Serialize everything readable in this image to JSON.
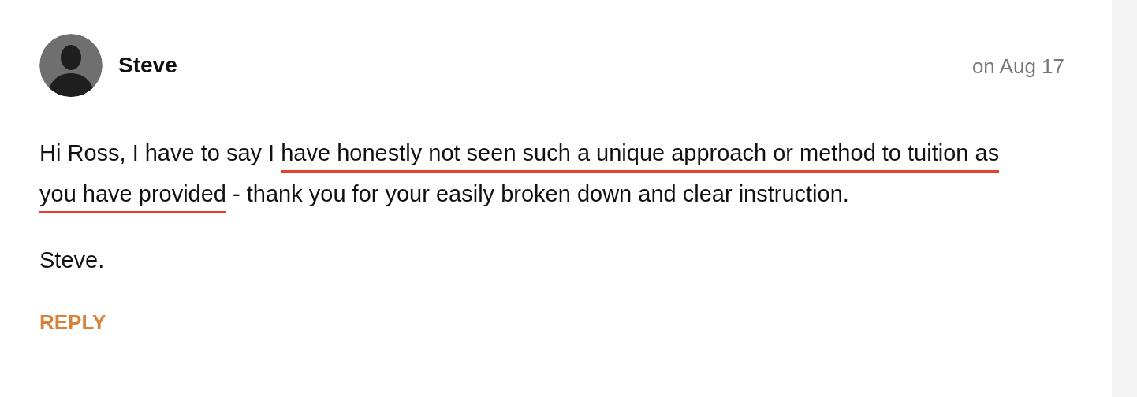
{
  "comment": {
    "author": "Steve",
    "date": "on Aug 17",
    "body": [
      {
        "text": "Hi Ross, I have to say I ",
        "underlined": false
      },
      {
        "text": "have honestly not seen such a unique approach or method to tuition as you have provided",
        "underlined": true
      },
      {
        "text": " - thank you for your easily broken down and clear instruction.",
        "underlined": false
      }
    ],
    "signoff": "Steve.",
    "reply": "REPLY"
  }
}
